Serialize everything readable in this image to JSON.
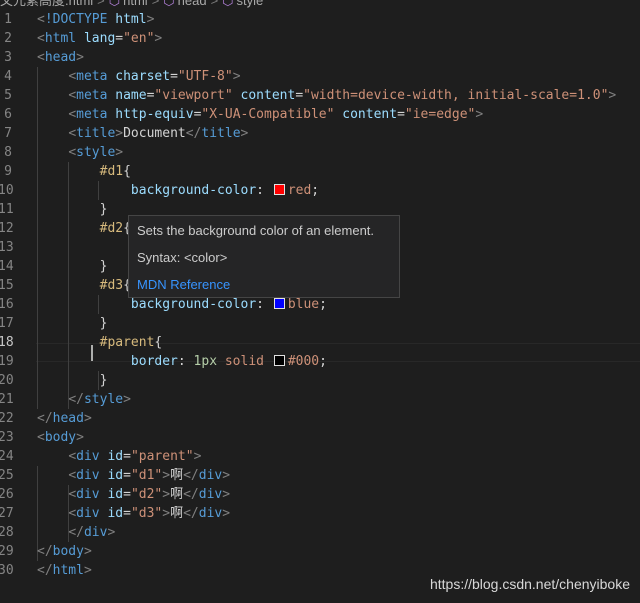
{
  "breadcrumb": {
    "file": "文元素高度.html",
    "items": [
      "html",
      "head",
      "style"
    ],
    "separator": ">"
  },
  "editor": {
    "active_line": 18,
    "lines": [
      {
        "num": "1"
      },
      {
        "num": "2"
      },
      {
        "num": "3"
      },
      {
        "num": "4"
      },
      {
        "num": "5"
      },
      {
        "num": "6"
      },
      {
        "num": "7"
      },
      {
        "num": "8"
      },
      {
        "num": "9"
      },
      {
        "num": "10"
      },
      {
        "num": "11"
      },
      {
        "num": "12"
      },
      {
        "num": "13"
      },
      {
        "num": "14"
      },
      {
        "num": "15"
      },
      {
        "num": "16"
      },
      {
        "num": "17"
      },
      {
        "num": "18"
      },
      {
        "num": "19"
      },
      {
        "num": "20"
      },
      {
        "num": "21"
      },
      {
        "num": "22"
      },
      {
        "num": "23"
      },
      {
        "num": "24"
      },
      {
        "num": "25"
      },
      {
        "num": "26"
      },
      {
        "num": "27"
      },
      {
        "num": "28"
      },
      {
        "num": "29"
      },
      {
        "num": "30"
      }
    ],
    "colors": {
      "red": "#ff0000",
      "blue": "#0000ff",
      "black": "#000000"
    }
  },
  "hover": {
    "description": "Sets the background color of an element.",
    "syntax": "Syntax: <color>",
    "link": "MDN Reference"
  },
  "watermark": "https://blog.csdn.net/chenyiboke"
}
